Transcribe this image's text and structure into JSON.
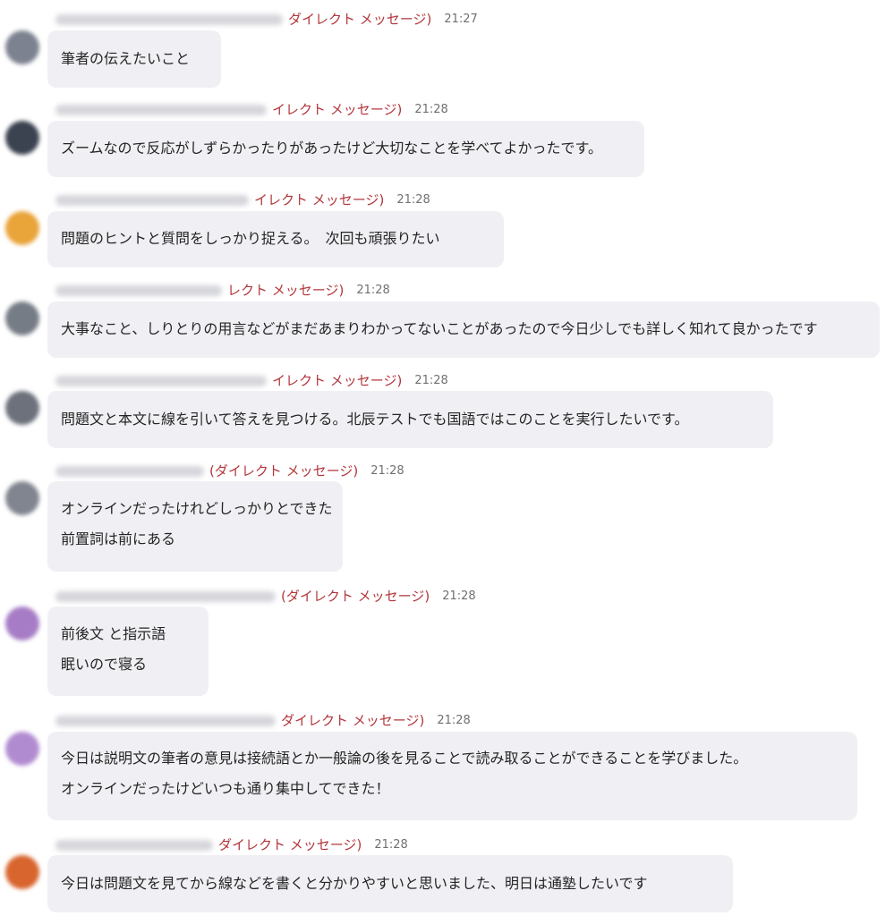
{
  "colors": {
    "bubble": "#f0f0f4",
    "dm_label": "#b3373c",
    "time": "#707070",
    "text": "#242424"
  },
  "messages": [
    {
      "dm_label": "ダイレクト メッセージ)",
      "time": "21:27",
      "avatar_color": "#7c8290",
      "lines": [
        "筆者の伝えたいこと"
      ]
    },
    {
      "dm_label": "イレクト メッセージ)",
      "time": "21:28",
      "avatar_color": "#3b4250",
      "lines": [
        "ズームなので反応がしずらかったりがあったけど大切なことを学べてよかったです。"
      ]
    },
    {
      "dm_label": "イレクト メッセージ)",
      "time": "21:28",
      "avatar_color": "#e9a43a",
      "lines": [
        "問題のヒントと質問をしっかり捉える。　次回も頑張りたい"
      ]
    },
    {
      "dm_label": "レクト メッセージ)",
      "time": "21:28",
      "avatar_color": "#767c86",
      "lines": [
        "大事なこと、しりとりの用言などがまだあまりわかってないことがあったので今日少しでも詳しく知れて良かったです"
      ]
    },
    {
      "dm_label": "イレクト メッセージ)",
      "time": "21:28",
      "avatar_color": "#6c717b",
      "lines": [
        "問題文と本文に線を引いて答えを見つける。北辰テストでも国語ではこのことを実行したいです。"
      ]
    },
    {
      "dm_label": "(ダイレクト メッセージ)",
      "time": "21:28",
      "avatar_color": "#80858f",
      "lines": [
        "オンラインだったけれどしっかりとできた",
        "前置詞は前にある"
      ]
    },
    {
      "dm_label": "(ダイレクト メッセージ)",
      "time": "21:28",
      "avatar_color": "#a77cc6",
      "lines": [
        "前後文 と指示語",
        "眠いので寝る"
      ]
    },
    {
      "dm_label": "ダイレクト メッセージ)",
      "time": "21:28",
      "avatar_color": "#b18bd0",
      "lines": [
        "今日は説明文の筆者の意見は接続語とか一般論の後を見ることで読み取ることができることを学びました。",
        "オンラインだったけどいつも通り集中してできた！"
      ]
    },
    {
      "dm_label": "ダイレクト メッセージ)",
      "time": "21:28",
      "avatar_color": "#d8652e",
      "lines": [
        "今日は問題文を見てから線などを書くと分かりやすいと思いました、明日は通塾したいです"
      ]
    }
  ]
}
